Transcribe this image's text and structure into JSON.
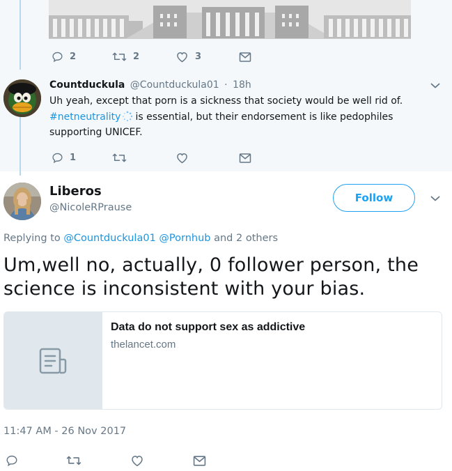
{
  "thread_top": {
    "actions": {
      "reply_count": "2",
      "retweet_count": "2",
      "like_count": "3"
    }
  },
  "reply_tweet": {
    "author_name": "Countduckula",
    "author_handle": "@Countduckula01",
    "separator": "·",
    "time": "18h",
    "text_part1": "Uh yeah, except that porn is a sickness that society would be well rid of.",
    "hashtag": "#netneutrality",
    "text_part2": "is essential, but their endorsement is like pedophiles supporting UNICEF.",
    "actions": {
      "reply_count": "1"
    }
  },
  "main_tweet": {
    "author_name": "Liberos",
    "author_handle": "@NicoleRPrause",
    "follow_label": "Follow",
    "replying_prefix": "Replying to",
    "replying_mention1": "@Countduckula01",
    "replying_mention2": "@Pornhub",
    "replying_suffix": "and 2 others",
    "text": "Um,well no, actually, 0 follower person, the science is inconsistent with your bias.",
    "card": {
      "title": "Data do not support sex as addictive",
      "domain": "thelancet.com"
    },
    "timestamp": "11:47 AM - 26 Nov 2017"
  },
  "colors": {
    "accent": "#1da1f2",
    "link": "#1b95e0",
    "muted": "#657786",
    "thread_bg": "#f5f8fa",
    "thread_line": "#b8d7ec"
  },
  "icons": [
    "reply-icon",
    "retweet-icon",
    "like-icon",
    "direct-message-icon",
    "chevron-down-icon",
    "article-icon"
  ]
}
